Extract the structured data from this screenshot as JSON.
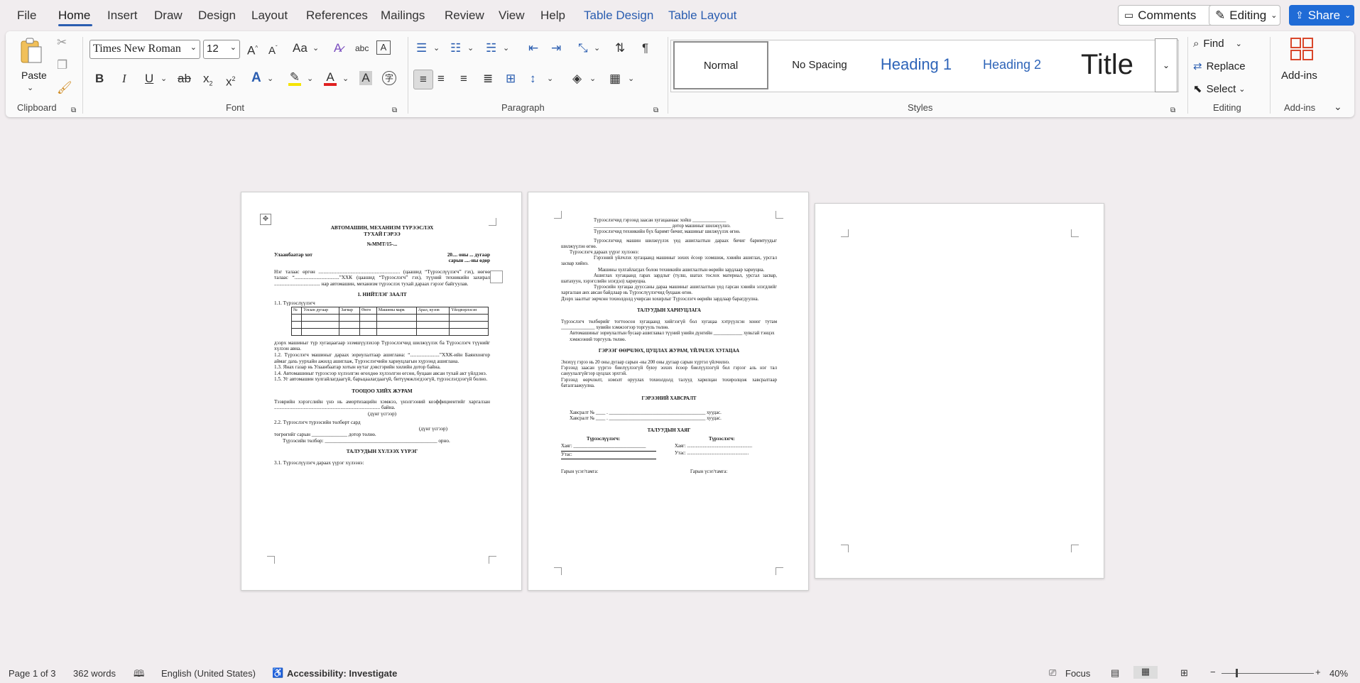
{
  "menu": {
    "items": [
      "File",
      "Home",
      "Insert",
      "Draw",
      "Design",
      "Layout",
      "References",
      "Mailings",
      "Review",
      "View",
      "Help"
    ],
    "contextual": [
      "Table Design",
      "Table Layout"
    ],
    "comments": "Comments",
    "editing": "Editing",
    "share": "Share"
  },
  "ribbon": {
    "clipboard": {
      "paste": "Paste",
      "label": "Clipboard"
    },
    "font": {
      "name": "Times New Roman",
      "size": "12",
      "label": "Font"
    },
    "paragraph": {
      "label": "Paragraph"
    },
    "styles": {
      "label": "Styles",
      "items": [
        "Normal",
        "No Spacing",
        "Heading 1",
        "Heading 2",
        "Title"
      ]
    },
    "editing": {
      "label": "Editing",
      "find": "Find",
      "replace": "Replace",
      "select": "Select"
    },
    "addins": {
      "label": "Add-ins",
      "button": "Add-ins"
    }
  },
  "colors": {
    "accent": "#2a5db0",
    "share_bg": "#1f6bd6",
    "highlight": "#f5e400",
    "font_color": "#e02020"
  },
  "page1": {
    "title1": "АВТОМАШИН, МЕХАНИЗМ ТҮРЭЭСЛЭХ",
    "title2": "ТУХАЙ ГЭРЭЭ",
    "number": "№ММТ/15-...",
    "city": "Улаанбаатар хот",
    "date1": "20.... оны ... дугаар",
    "date2": "сарын ....-ны өдөр",
    "intro": "Нэг талаас өргөн ................................................................ (цаашид “Түрээслүүлэгч” гэх), нөгөө талаас “...................................”ХХК (цаашид “Түрээслэгч” гэх), түүний техникийн захирал .................................... нар автомашин, механизм түрээслэх тухай дараах гэрээг байгуулав.",
    "sec1": "1. НИЙТЛЭГ ЗААЛТ",
    "item11": "1.1.        Түрээслүүлэгч",
    "table_headers": [
      "№",
      "Улсын дугаар",
      "Загвар",
      "Өнгө",
      "Машины марк",
      "Арал, кузов",
      "Үйлдвэрлэсэн"
    ],
    "para1": "дээрх машиныг түр хугацаагаар эзэмшүүлэхээр Түрээслэгчид шилжүүлэх ба Түрээслэгч түүнийг хүлээн авна.",
    "para2": "1.2. Түрээслэгч машиныг дараах зориулалтаар ашиглана: “.......................”ХХК-ийн Баянхонгор аймаг дахь уурхайн ажилд ашиглаж, Түрээслэгчийн хариуцлагын хүрээнд ашиглана.",
    "para3": "1.3. Янах газар нь Улаанбаатар хотын нутаг дэвсгэрийн хилийн дотор байна.",
    "para4": "1.4. Автомашиныг түрээсээр хүлээлгэн өгөхдөө хүлээлгэн өгсөн, буцаан авсан тухай акт үйлдэнэ.",
    "para5": "1.5. Уг автомашин хулгайлагдаагүй, барьцаалагдаагүй, битүүмжлэгдээгүй, түрээслэгдээгүй болно.",
    "sec2": "ТООЦОО ХИЙХ ЖУРАМ",
    "para6": "Тээврийн хэрэгслийн үнэ нь амортизацийн хэмжээ, үнэлгээний коэффициентийг харгалзан ................................................................................... байна.",
    "para6b": "(дүнг үсгээр)",
    "para7": "2.2. Түрээслэгч түрээсийн төлбөрт сард",
    "para7b": "(дүнг үсгээр)",
    "para8": "төгрөгийг сарын ______________ дотор төлнө.",
    "para9": "Түрээсийн төлбөр: ____________________________________________ орно.",
    "sec3": "ТАЛУУДЫН ХҮЛЭЭХ ҮҮРЭГ",
    "para10": "3.1. Түрээслүүлэгч дараах үүрэг хүлээнэ:"
  },
  "page2": {
    "p1": "Түрээслэгчид гэрээнд заасан хугацаанаас хойш ______________",
    "p2": "________________________________ дотор машиныг шилжүүлнэ.",
    "p3": "Түрээслэгчид техникийн бүх баримт бичиг, машиныг шилжүүлэх өгнө.",
    "p4": "Түрээслэгчид машин шилжүүлэх үед ашиглалтын дараах бичиг баримтуудыг шилжүүлэн өгнө.",
    "p5": "Түрээслэгч дараах үүрэг хүлээнэ:",
    "p6": "Гэрээний үйлчлэх хугацаанд машиныг зохих ёсоор эзэмшиж, хэвийн ашиглах, урсгал засвар хийнэ.",
    "p7": "Машины хулгайлагдах болон техникийн ашиглалтын өөрийн зардлаар хариуцна.",
    "p8": "Ашиглах хугацаанд гарах зардлыг (түлш, шатах тослох материал, урсгал засвар, шатахуун, хэрэгслийн элэгдэл) хариуцна.",
    "p9": "Түрээсийн хугацаа дууссаны дараа машиныг ашиглалтын үед гарсан хэвийн элэгдлийг харгалзан анх авсан байдлаар нь Түрээслүүлэгчид буцааж өгнө.",
    "p10": "Дээрх заалтыг зөрчсөн тохиолдолд учирсан хохирлыг Түрээслэгч өөрийн зардлаар барагдуулна.",
    "sec1": "ТАЛУУДЫН ХАРИУЦЛАГА",
    "p11": "Түрээслэгч төлбөрийг тогтоосон хугацаанд хийгээгүй бол хугацаа хэтрүүлсэн хоног тутам ______________ хувийн хэмжээгээр торгууль төлнө.",
    "p12": "Автомашиныг зориулалтын бусаар ашиглавал түүний үнийн дүнгийн ____________ хувьтай тэнцэх хэмжээний торгууль төлнө.",
    "sec2": "ГЭРЭЭГ ӨӨРЧЛӨХ, ЦУЦЛАХ ЖУРАМ, ҮЙЛЧЛЭХ ХУГАЦАА",
    "p13": "Энэхүү гэрээ нь 20 оны дугаар сарын -ны 200 оны дугаар сарын хүртэл үйлчилнэ.",
    "p14": "Гэрээнд заасан үүргээ биелүүлээгүй буюу зохих ёсоор биелүүлээгүй бол гэрээг аль нэг тал сануулалгүйгээр цуцлах эрхтэй.",
    "p15": "Гэрээнд өөрчлөлт, нэмэлт оруулах тохиолдолд талууд харилцан тохиролцож хавсралтаар баталгаажуулна.",
    "sec3": "ГЭРЭЭНИЙ ХАВСРАЛТ",
    "att1": "Хавсралт № ____ . ________________________________________ хуудас.",
    "att2": "Хавсралт № ____ . ________________________________________ хуудас.",
    "sec4": "ТАЛУУДЫН ХАЯГ",
    "lessor": "Түрээслүүлэгч:",
    "lessee": "Түрээслэгч:",
    "addr1": "Хаяг: ______________________________",
    "addr2": "Хаяг: ......................................................",
    "phone1": "Утас: ",
    "phone2": "Утас: ...................................................",
    "sign1": "Гарын үсэг/тамга:",
    "sign2": "Гарын үсэг/тамга:"
  },
  "status": {
    "page": "Page 1 of 3",
    "words": "362 words",
    "language": "English (United States)",
    "accessibility": "Accessibility: Investigate",
    "focus": "Focus",
    "zoom": "40%"
  }
}
